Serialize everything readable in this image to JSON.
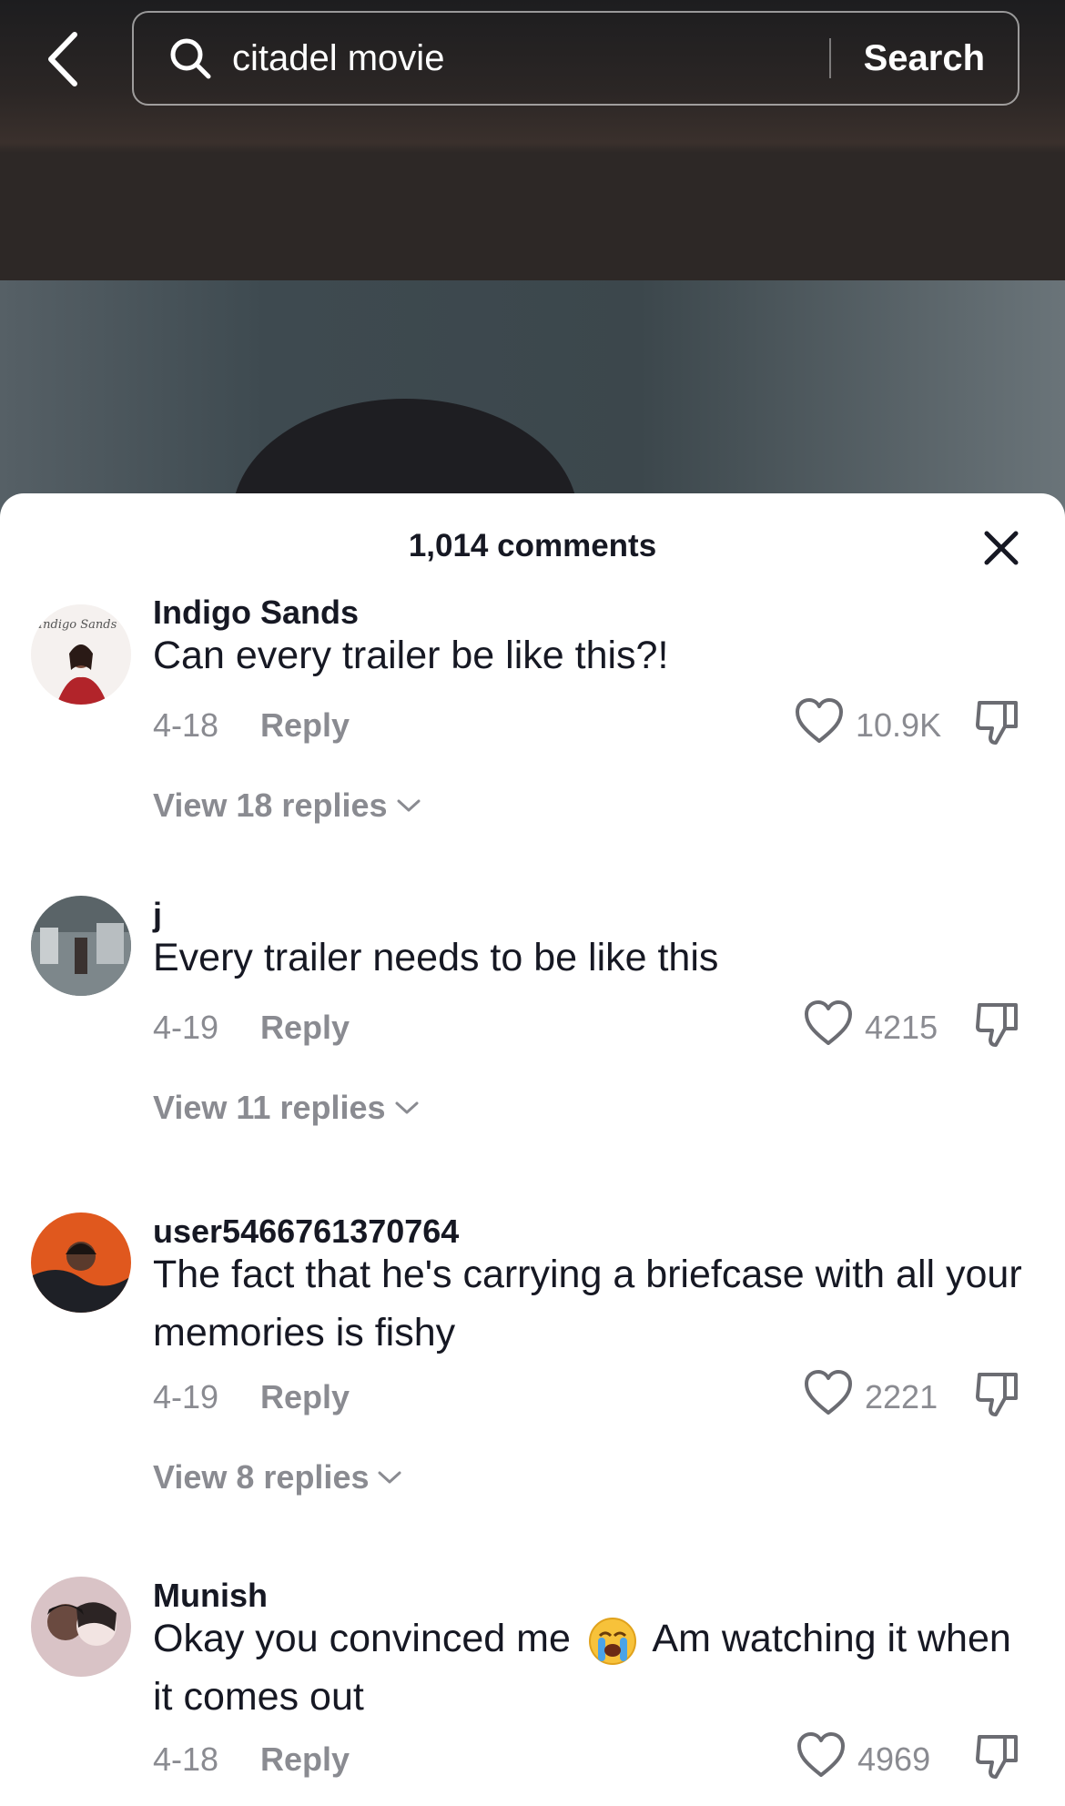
{
  "search": {
    "query": "citadel movie",
    "button_label": "Search",
    "icon": "search-icon"
  },
  "sheet": {
    "title": "1,014 comments",
    "close_icon": "close-icon"
  },
  "comments": [
    {
      "username": "Indigo Sands",
      "avatar_text": "Indigo Sands",
      "text": "Can every trailer be like this?!",
      "date": "4-18",
      "reply_label": "Reply",
      "likes": "10.9K",
      "view_replies": "View 18 replies"
    },
    {
      "username": "j",
      "text": "Every trailer needs to be like this",
      "date": "4-19",
      "reply_label": "Reply",
      "likes": "4215",
      "view_replies": "View 11 replies"
    },
    {
      "username": "user5466761370764",
      "text": "The fact that he's carrying a briefcase with all your memories is fishy",
      "date": "4-19",
      "reply_label": "Reply",
      "likes": "2221",
      "view_replies": "View 8 replies"
    },
    {
      "username": "Munish",
      "text_before_emoji": "Okay you convinced me",
      "emoji": "loudly-crying-face",
      "text_after_emoji": "Am watching it when it comes out",
      "date": "4-18",
      "reply_label": "Reply",
      "likes": "4969"
    }
  ],
  "colors": {
    "primary_text": "#161823",
    "secondary_text": "#8a8b91",
    "background": "#ffffff"
  }
}
